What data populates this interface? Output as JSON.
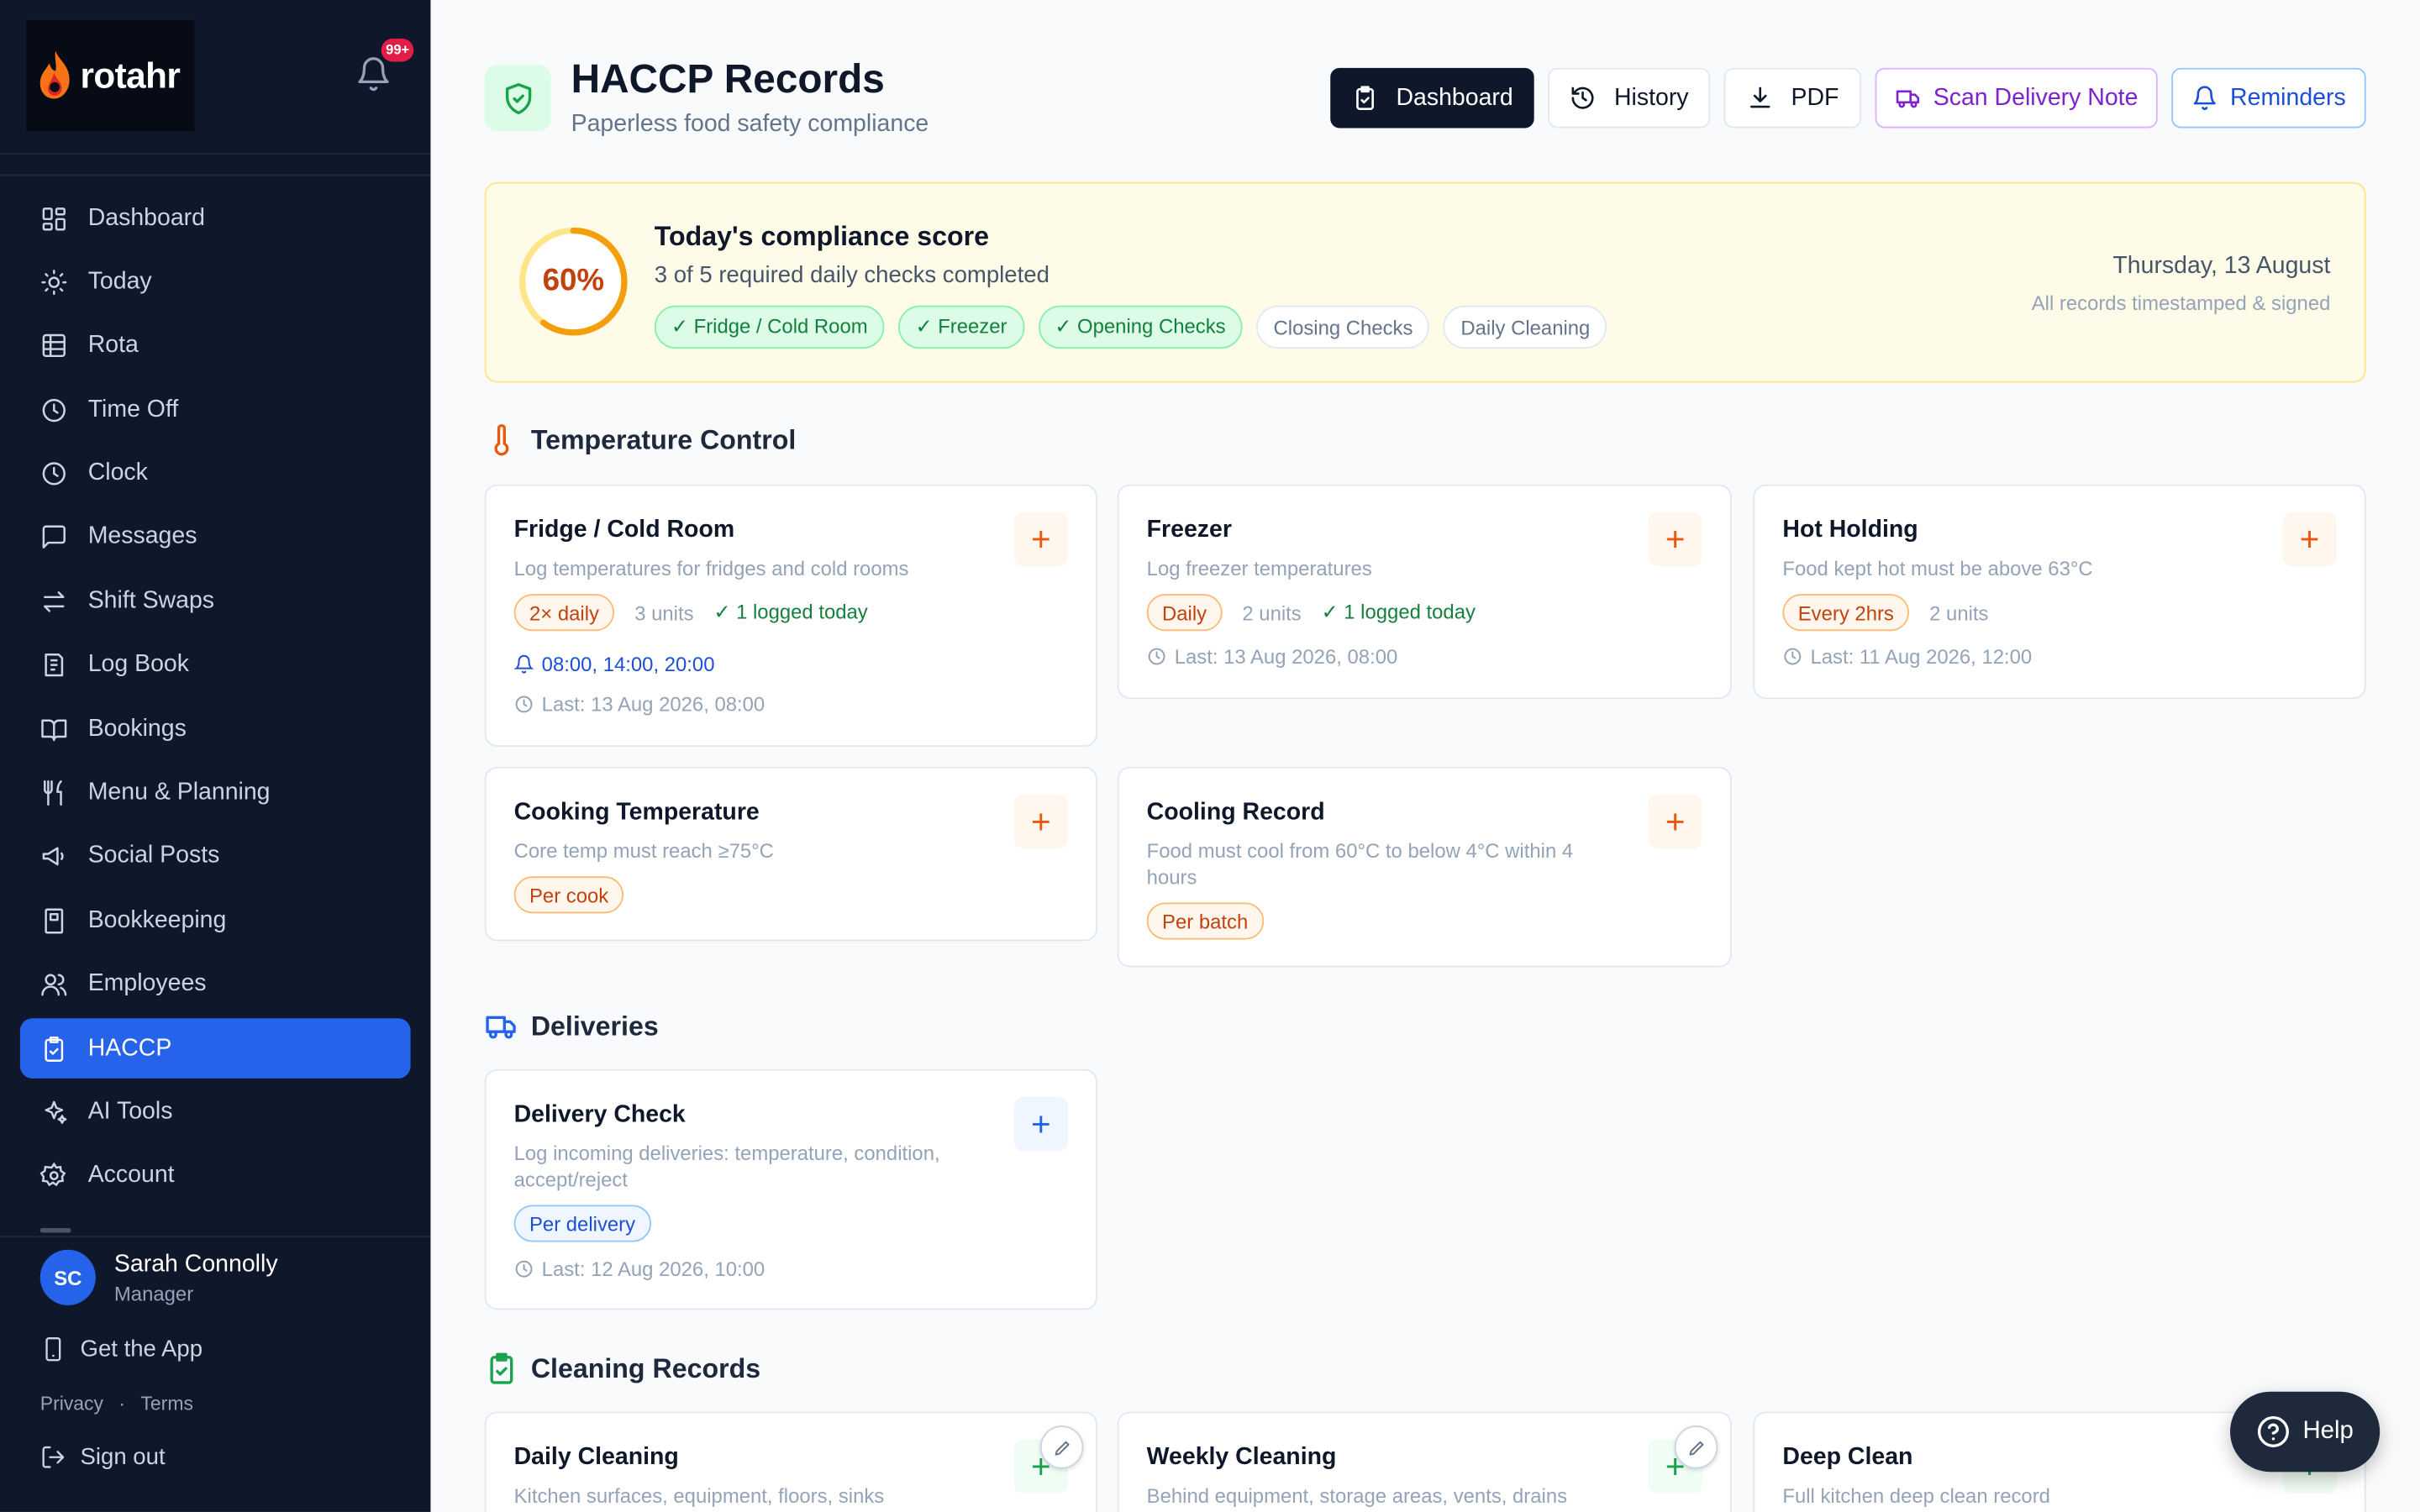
{
  "brand": {
    "name": "rotahr",
    "notification_count": "99+"
  },
  "sidebar": {
    "items": [
      {
        "label": "Dashboard",
        "icon": "dashboard-icon"
      },
      {
        "label": "Today",
        "icon": "sun-icon"
      },
      {
        "label": "Rota",
        "icon": "grid-icon"
      },
      {
        "label": "Time Off",
        "icon": "clock-icon"
      },
      {
        "label": "Clock",
        "icon": "clock-icon"
      },
      {
        "label": "Messages",
        "icon": "message-icon"
      },
      {
        "label": "Shift Swaps",
        "icon": "swap-icon"
      },
      {
        "label": "Log Book",
        "icon": "logbook-icon"
      },
      {
        "label": "Bookings",
        "icon": "book-icon"
      },
      {
        "label": "Menu & Planning",
        "icon": "utensils-icon"
      },
      {
        "label": "Social Posts",
        "icon": "megaphone-icon"
      },
      {
        "label": "Bookkeeping",
        "icon": "ledger-icon"
      },
      {
        "label": "Employees",
        "icon": "users-icon"
      },
      {
        "label": "HACCP",
        "icon": "clipboard-check-icon",
        "active": true
      },
      {
        "label": "AI Tools",
        "icon": "sparkles-icon"
      },
      {
        "label": "Account",
        "icon": "gear-icon"
      }
    ],
    "user": {
      "initials": "SC",
      "name": "Sarah Connolly",
      "role": "Manager"
    },
    "get_app": "Get the App",
    "privacy": "Privacy",
    "terms": "Terms",
    "sign_out": "Sign out"
  },
  "header": {
    "title": "HACCP Records",
    "subtitle": "Paperless food safety compliance",
    "buttons": {
      "dashboard": "Dashboard",
      "history": "History",
      "pdf": "PDF",
      "scan": "Scan Delivery Note",
      "reminders": "Reminders"
    }
  },
  "compliance": {
    "percent_label": "60%",
    "percent": 60,
    "title": "Today's compliance score",
    "subtitle": "3 of 5 required daily checks completed",
    "checks": [
      {
        "label": "✓ Fridge / Cold Room",
        "done": true
      },
      {
        "label": "✓ Freezer",
        "done": true
      },
      {
        "label": "✓ Opening Checks",
        "done": true
      },
      {
        "label": "Closing Checks",
        "done": false
      },
      {
        "label": "Daily Cleaning",
        "done": false
      }
    ],
    "date": "Thursday, 13 August",
    "note": "All records timestamped & signed"
  },
  "sections": {
    "temperature": "Temperature Control",
    "deliveries": "Deliveries",
    "cleaning": "Cleaning Records"
  },
  "cards": {
    "fridge": {
      "title": "Fridge / Cold Room",
      "desc": "Log temperatures for fridges and cold rooms",
      "freq": "2× daily",
      "units": "3 units",
      "logged": "✓ 1 logged today",
      "reminders": "08:00, 14:00, 20:00",
      "last": "Last: 13 Aug 2026, 08:00"
    },
    "freezer": {
      "title": "Freezer",
      "desc": "Log freezer temperatures",
      "freq": "Daily",
      "units": "2 units",
      "logged": "✓ 1 logged today",
      "last": "Last: 13 Aug 2026, 08:00"
    },
    "hot": {
      "title": "Hot Holding",
      "desc": "Food kept hot must be above 63°C",
      "freq": "Every 2hrs",
      "units": "2 units",
      "last": "Last: 11 Aug 2026, 12:00"
    },
    "cooking": {
      "title": "Cooking Temperature",
      "desc": "Core temp must reach ≥75°C",
      "freq": "Per cook"
    },
    "cooling": {
      "title": "Cooling Record",
      "desc": "Food must cool from 60°C to below 4°C within 4 hours",
      "freq": "Per batch"
    },
    "delivery": {
      "title": "Delivery Check",
      "desc": "Log incoming deliveries: temperature, condition, accept/reject",
      "freq": "Per delivery",
      "last": "Last: 12 Aug 2026, 10:00"
    },
    "daily_clean": {
      "title": "Daily Cleaning",
      "desc": "Kitchen surfaces, equipment, floors, sinks"
    },
    "weekly_clean": {
      "title": "Weekly Cleaning",
      "desc": "Behind equipment, storage areas, vents, drains"
    },
    "deep_clean": {
      "title": "Deep Clean",
      "desc": "Full kitchen deep clean record"
    }
  },
  "help": {
    "label": "Help"
  },
  "colors": {
    "accent": "#2563eb",
    "sidebar_bg": "#0f172a",
    "score_ring": "#f59e0b",
    "success": "#15803d"
  }
}
